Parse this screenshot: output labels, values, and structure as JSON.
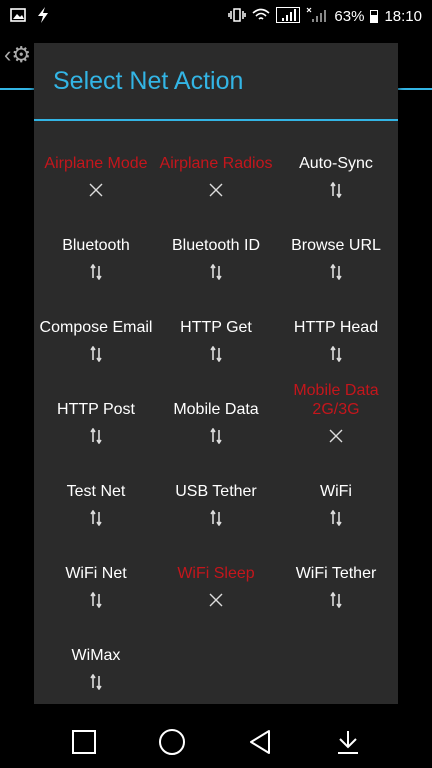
{
  "status": {
    "battery": "63%",
    "time": "18:10",
    "icons": [
      "image-icon",
      "flash-icon",
      "vibrate-icon",
      "wifi-icon",
      "signal-r-icon",
      "signal-x-icon",
      "battery-icon"
    ]
  },
  "dialog": {
    "title": "Select Net Action"
  },
  "actions": [
    {
      "label": "Airplane Mode",
      "state": "disabled",
      "icon": "x-icon"
    },
    {
      "label": "Airplane Radios",
      "state": "disabled",
      "icon": "x-icon"
    },
    {
      "label": "Auto-Sync",
      "state": "enabled",
      "icon": "arrows-icon"
    },
    {
      "label": "Bluetooth",
      "state": "enabled",
      "icon": "arrows-icon"
    },
    {
      "label": "Bluetooth ID",
      "state": "enabled",
      "icon": "arrows-icon"
    },
    {
      "label": "Browse URL",
      "state": "enabled",
      "icon": "arrows-icon"
    },
    {
      "label": "Compose Email",
      "state": "enabled",
      "icon": "arrows-icon"
    },
    {
      "label": "HTTP Get",
      "state": "enabled",
      "icon": "arrows-icon"
    },
    {
      "label": "HTTP Head",
      "state": "enabled",
      "icon": "arrows-icon"
    },
    {
      "label": "HTTP Post",
      "state": "enabled",
      "icon": "arrows-icon"
    },
    {
      "label": "Mobile Data",
      "state": "enabled",
      "icon": "arrows-icon"
    },
    {
      "label": "Mobile Data 2G/3G",
      "state": "disabled",
      "icon": "x-icon"
    },
    {
      "label": "Test Net",
      "state": "enabled",
      "icon": "arrows-icon"
    },
    {
      "label": "USB Tether",
      "state": "enabled",
      "icon": "arrows-icon"
    },
    {
      "label": "WiFi",
      "state": "enabled",
      "icon": "arrows-icon"
    },
    {
      "label": "WiFi Net",
      "state": "enabled",
      "icon": "arrows-icon"
    },
    {
      "label": "WiFi Sleep",
      "state": "disabled",
      "icon": "x-icon"
    },
    {
      "label": "WiFi Tether",
      "state": "enabled",
      "icon": "arrows-icon"
    },
    {
      "label": "WiMax",
      "state": "enabled",
      "icon": "arrows-icon"
    }
  ],
  "colors": {
    "accent": "#33b5e5",
    "disabled_text": "#c4161c",
    "dialog_bg": "#2b2b2b"
  },
  "navbar": [
    "recents-icon",
    "home-icon",
    "back-icon",
    "download-icon"
  ]
}
